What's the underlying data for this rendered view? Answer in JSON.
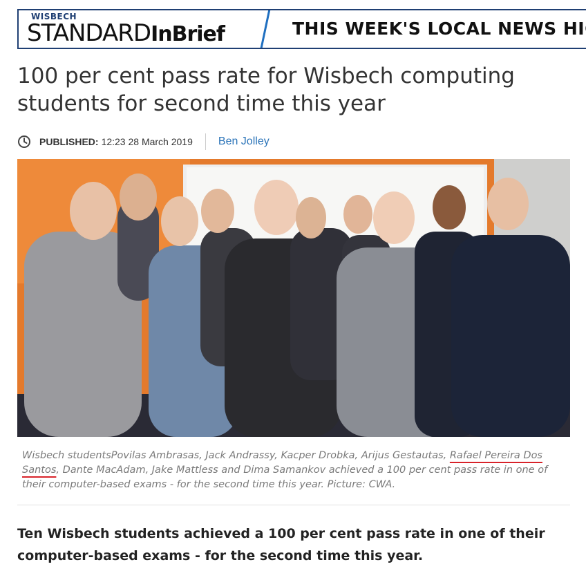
{
  "banner": {
    "brand_small": "WISBECH",
    "brand_main": "STANDARD",
    "brand_sub": "InBrief",
    "news_text": "THIS WEEK'S LOCAL NEWS HIG"
  },
  "article": {
    "headline": "100 per cent pass rate for Wisbech computing students for second time this year",
    "published_label": "PUBLISHED:",
    "published_value": "12:23 28 March 2019",
    "author": "Ben Jolley",
    "caption_part1": "Wisbech studentsPovilas Ambrasas, Jack Andrassy, Kacper Drobka, Arijus Gestautas, ",
    "caption_underlined_1": "Rafael Pereira Dos",
    "caption_space": " ",
    "caption_underlined_2": "Santos",
    "caption_part2": ", Dante MacAdam, Jake Mattless and Dima Samankov achieved a 100 per cent pass rate in one of their computer-based exams - for the second time this year. Picture: CWA.",
    "lead": "Ten Wisbech students achieved a 100 per cent pass rate in one of their computer-based exams - for the second time this year."
  },
  "icons": {
    "published": "clock-icon"
  },
  "colors": {
    "brand_blue": "#1f3f73",
    "accent_blue": "#1f6fc0",
    "link": "#2a73b8",
    "underline_red": "#d8232a",
    "caption_gray": "#7a7a7a"
  }
}
